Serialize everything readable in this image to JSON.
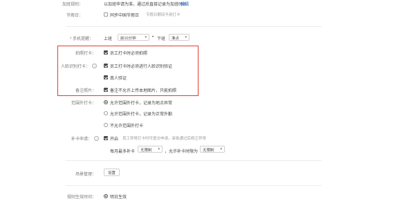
{
  "rows": {
    "add_rule": {
      "label": "加班规则：",
      "text": "以加班申请为准，通过后直接记录为加班时长",
      "link": "编辑"
    },
    "holiday": {
      "label": "节假日：",
      "check_label": "同步中国节假日",
      "hint": "节假日期间不用打卡"
    },
    "reminder": {
      "label": "* 手机提醒：",
      "on_text": "上班",
      "on_value": "前10分钟",
      "sep": "•",
      "off_text": "下班",
      "off_value": "准点"
    },
    "photo": {
      "label": "拍照打卡：",
      "option": "员工打卡时必须拍照"
    },
    "face": {
      "label": "人脸识别打卡：",
      "option1": "员工打卡时必须进行人脸识别验证",
      "option2": "真人验证"
    },
    "album": {
      "label": "备注照片：",
      "option": "备注不允许上传本地图片，只能拍照"
    },
    "outside": {
      "label": "范围外打卡：",
      "options": [
        "允许范围外打卡，记录为地点异常",
        "允许范围外打卡，记录为正常外勤",
        "不允许范围外打卡"
      ]
    },
    "supplement": {
      "label": "补卡申请：",
      "check_label": "开启",
      "hint": "员工异常打卡时可提交申请，审批通过后修正异常",
      "per_month_label": "每月最多补卡",
      "per_month_value": "无限制",
      "days_label": "，允许补卡时限为",
      "days_value": "无限制"
    },
    "locations": {
      "label": "场景管理：",
      "button": "设置"
    },
    "effective": {
      "label": "规则生效时间：",
      "option": "明日生效"
    }
  },
  "icons": {
    "dropdown": "chevron-down-icon",
    "help": "question-icon"
  },
  "colors": {
    "highlight": "#e03a32",
    "link": "#2f6fcf"
  }
}
